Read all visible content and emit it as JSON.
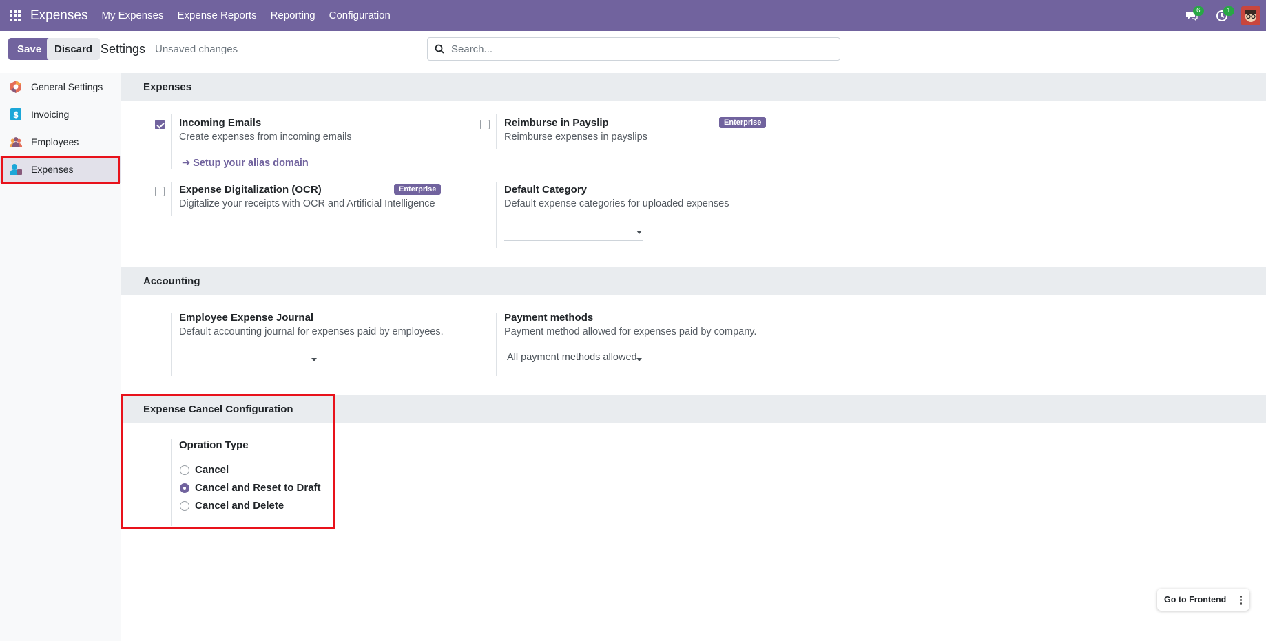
{
  "navbar": {
    "brand": "Expenses",
    "menu": [
      "My Expenses",
      "Expense Reports",
      "Reporting",
      "Configuration"
    ],
    "messages_count": "6",
    "activities_count": "1"
  },
  "control_panel": {
    "save_label": "Save",
    "discard_label": "Discard",
    "title": "Settings",
    "status": "Unsaved changes",
    "search_placeholder": "Search..."
  },
  "sidebar": {
    "items": [
      {
        "label": "General Settings",
        "icon": "odoo-logo-icon"
      },
      {
        "label": "Invoicing",
        "icon": "invoicing-icon"
      },
      {
        "label": "Employees",
        "icon": "employees-icon"
      },
      {
        "label": "Expenses",
        "icon": "expenses-icon",
        "active": true
      }
    ]
  },
  "sections": {
    "expenses": {
      "title": "Expenses",
      "incoming_emails": {
        "title": "Incoming Emails",
        "desc": "Create expenses from incoming emails",
        "checked": true,
        "link": "Setup your alias domain"
      },
      "reimburse_payslip": {
        "title": "Reimburse in Payslip",
        "desc": "Reimburse expenses in payslips",
        "checked": false,
        "badge": "Enterprise"
      },
      "ocr": {
        "title": "Expense Digitalization (OCR)",
        "desc": "Digitalize your receipts with OCR and Artificial Intelligence",
        "checked": false,
        "badge": "Enterprise"
      },
      "default_category": {
        "title": "Default Category",
        "desc": "Default expense categories for uploaded expenses",
        "value": ""
      }
    },
    "accounting": {
      "title": "Accounting",
      "journal": {
        "title": "Employee Expense Journal",
        "desc": "Default accounting journal for expenses paid by employees.",
        "value": ""
      },
      "payment_methods": {
        "title": "Payment methods",
        "desc": "Payment method allowed for expenses paid by company.",
        "value": "All payment methods allowed"
      }
    },
    "cancel_config": {
      "title": "Expense Cancel Configuration",
      "operation_type_label": "Opration Type",
      "options": [
        {
          "label": "Cancel",
          "checked": false
        },
        {
          "label": "Cancel and Reset to Draft",
          "checked": true
        },
        {
          "label": "Cancel and Delete",
          "checked": false
        }
      ]
    }
  },
  "frontend_button": "Go to Frontend",
  "colors": {
    "brand": "#71639e",
    "highlight": "#e8121b",
    "section_bg": "#e9ecef"
  }
}
